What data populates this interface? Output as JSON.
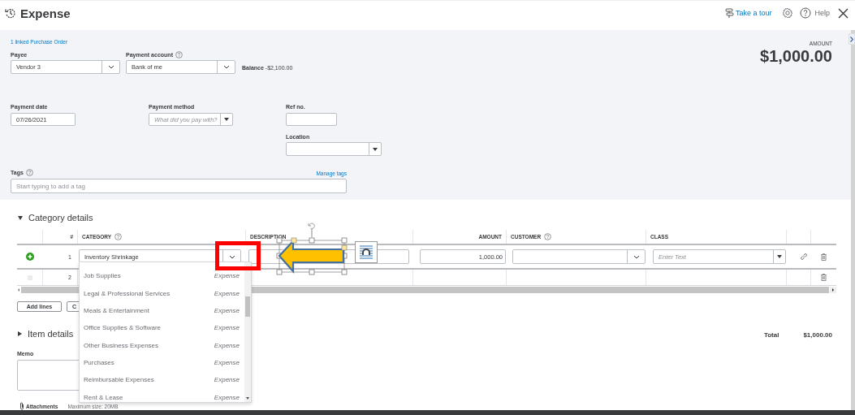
{
  "header": {
    "title": "Expense",
    "tour_link": "Take a tour",
    "help_button": "Help"
  },
  "form": {
    "linked_link": "1 linked Purchase Order",
    "payee": {
      "label": "Payee",
      "value": "Vendor 3"
    },
    "payment_account": {
      "label": "Payment account",
      "value": "Bank of me"
    },
    "balance": {
      "label": "Balance",
      "value": "-$2,100.00"
    },
    "amount": {
      "label": "AMOUNT",
      "value": "$1,000.00"
    },
    "payment_date": {
      "label": "Payment date",
      "value": "07/26/2021"
    },
    "payment_method": {
      "label": "Payment method",
      "placeholder": "What did you pay with?"
    },
    "ref_no": {
      "label": "Ref no."
    },
    "location": {
      "label": "Location"
    },
    "tags": {
      "label": "Tags",
      "manage_link": "Manage tags",
      "placeholder": "Start typing to add a tag"
    }
  },
  "category_details": {
    "title": "Category details",
    "expanded": true,
    "columns": [
      {
        "label": "#",
        "help": false
      },
      {
        "label": "CATEGORY",
        "help": true
      },
      {
        "label": "DESCRIPTION",
        "help": false
      },
      {
        "label": "AMOUNT",
        "help": false
      },
      {
        "label": "CUSTOMER",
        "help": true
      },
      {
        "label": "CLASS",
        "help": false
      }
    ],
    "rows": [
      {
        "number": "1",
        "editing": true,
        "category": "Inventory Shrinkage",
        "amount": "1,000.00",
        "class_placeholder": "Enter Text"
      },
      {
        "number": "2",
        "editing": false
      }
    ],
    "buttons": [
      "Add lines",
      "C"
    ]
  },
  "category_dropdown": {
    "options": [
      {
        "name": "Job Supplies",
        "type": "Expense"
      },
      {
        "name": "Legal & Professional Services",
        "type": "Expense"
      },
      {
        "name": "Meals & Entertainment",
        "type": "Expense"
      },
      {
        "name": "Office Supplies & Software",
        "type": "Expense"
      },
      {
        "name": "Other Business Expenses",
        "type": "Expense"
      },
      {
        "name": "Purchases",
        "type": "Expense"
      },
      {
        "name": "Reimbursable Expenses",
        "type": "Expense"
      },
      {
        "name": "Rent & Lease",
        "type": "Expense"
      }
    ]
  },
  "item_details": {
    "title": "Item details",
    "expanded": false
  },
  "total": {
    "label": "Total",
    "value": "$1,000.00"
  },
  "memo": {
    "label": "Memo"
  },
  "attachments": {
    "label": "Attachments",
    "note": "Maximum size: 20MB"
  }
}
